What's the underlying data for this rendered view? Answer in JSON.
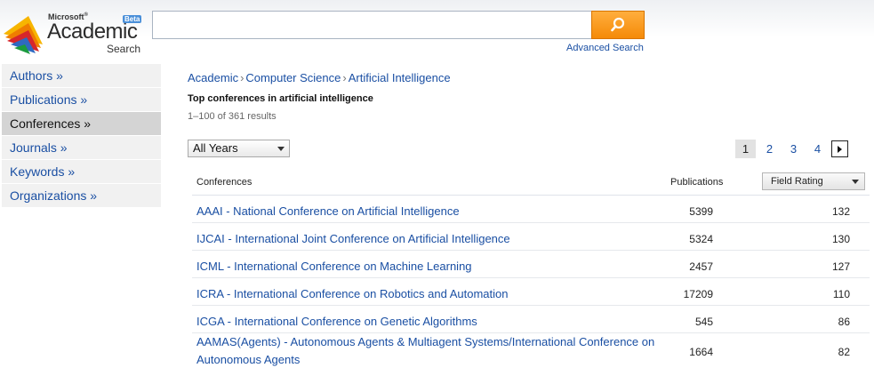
{
  "logo": {
    "brand": "Microsoft",
    "product": "Academic",
    "subtitle": "Search",
    "badge": "Beta"
  },
  "search": {
    "value": "",
    "placeholder": "",
    "button_icon": "search-icon",
    "advanced_label": "Advanced Search"
  },
  "sidebar": {
    "items": [
      {
        "label": "Authors »",
        "active": false
      },
      {
        "label": "Publications »",
        "active": false
      },
      {
        "label": "Conferences »",
        "active": true
      },
      {
        "label": "Journals »",
        "active": false
      },
      {
        "label": "Keywords »",
        "active": false
      },
      {
        "label": "Organizations »",
        "active": false
      }
    ]
  },
  "breadcrumb": [
    "Academic",
    "Computer Science",
    "Artificial Intelligence"
  ],
  "heading": "Top conferences in artificial intelligence",
  "results_count": "1–100 of 361 results",
  "filter": {
    "selected": "All Years"
  },
  "pager": {
    "pages": [
      "1",
      "2",
      "3",
      "4"
    ],
    "current": "1",
    "next_icon": "next-arrow-icon"
  },
  "table": {
    "headers": {
      "name": "Conferences",
      "publications": "Publications",
      "rating": "Field Rating"
    },
    "rows": [
      {
        "name": "AAAI - National Conference on Artificial Intelligence",
        "publications": "5399",
        "rating": "132"
      },
      {
        "name": "IJCAI - International Joint Conference on Artificial Intelligence",
        "publications": "5324",
        "rating": "130"
      },
      {
        "name": "ICML - International Conference on Machine Learning",
        "publications": "2457",
        "rating": "127"
      },
      {
        "name": "ICRA - International Conference on Robotics and Automation",
        "publications": "17209",
        "rating": "110"
      },
      {
        "name": "ICGA - International Conference on Genetic Algorithms",
        "publications": "545",
        "rating": "86"
      },
      {
        "name": "AAMAS(Agents) - Autonomous Agents & Multiagent Systems/International Conference on Autonomous Agents",
        "publications": "1664",
        "rating": "82"
      }
    ]
  },
  "colors": {
    "link": "#1a4fa3",
    "search_button": "#f58a08",
    "sidebar_active": "#d4d4d4",
    "sidebar_bg": "#f1f1f1"
  }
}
